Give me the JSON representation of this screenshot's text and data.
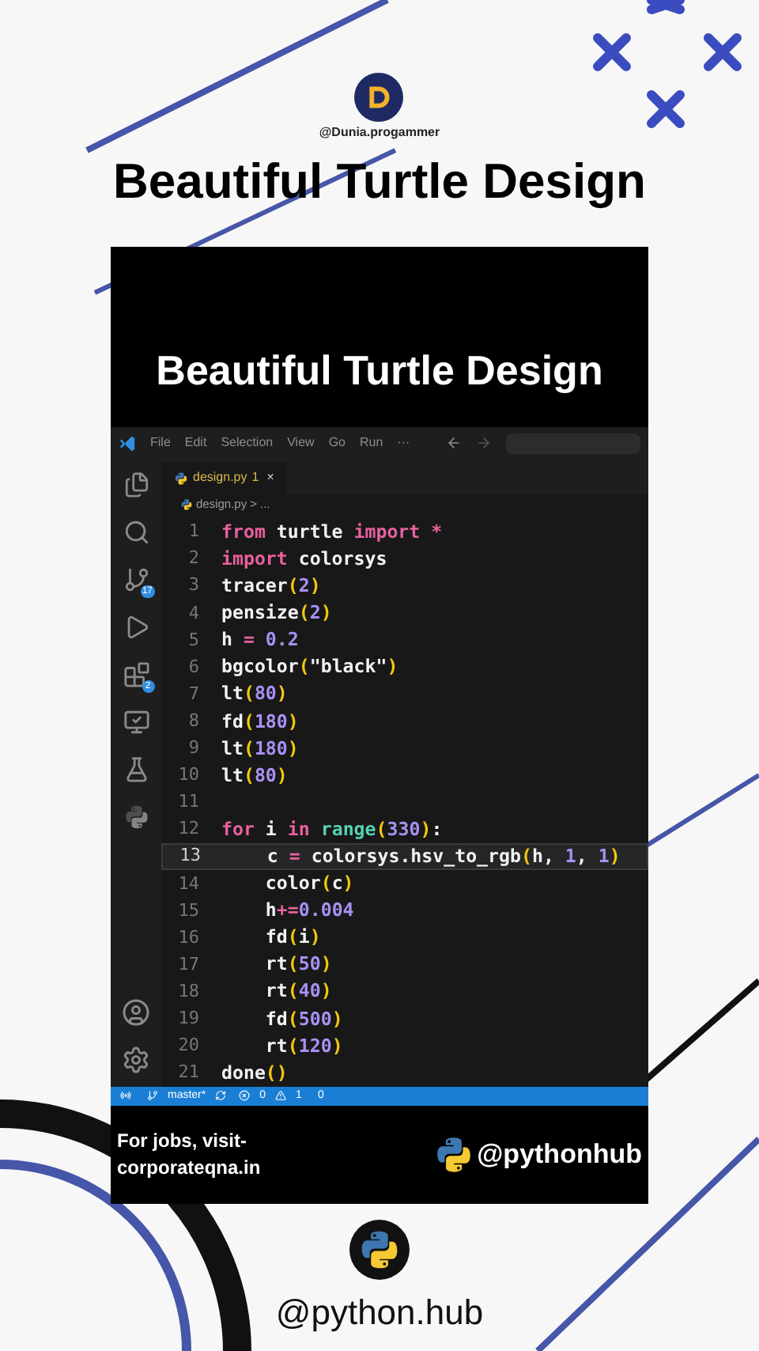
{
  "account": {
    "handle": "@Dunia.progammer"
  },
  "title": "Beautiful Turtle Design",
  "video": {
    "title": "Beautiful Turtle Design",
    "editor": {
      "menu": [
        "File",
        "Edit",
        "Selection",
        "View",
        "Go",
        "Run",
        "···"
      ],
      "activity": [
        {
          "kind": "files"
        },
        {
          "kind": "search"
        },
        {
          "kind": "scm",
          "badge": "17"
        },
        {
          "kind": "run"
        },
        {
          "kind": "extensions",
          "badge": "2"
        },
        {
          "kind": "remote"
        },
        {
          "kind": "testing"
        },
        {
          "kind": "python"
        }
      ],
      "activity_bottom": [
        {
          "kind": "account"
        },
        {
          "kind": "settings"
        }
      ],
      "tab": {
        "name": "design.py",
        "problems": "1",
        "close": "×"
      },
      "breadcrumb": [
        "design.py",
        ">",
        "..."
      ],
      "lines": [
        {
          "number": "1",
          "current": false,
          "tokens": [
            {
              "text": "from",
              "kind": "keyword"
            },
            {
              "text": " turtle ",
              "kind": "plain"
            },
            {
              "text": "import",
              "kind": "keyword"
            },
            {
              "text": " *",
              "kind": "keyword"
            }
          ]
        },
        {
          "number": "2",
          "current": false,
          "tokens": [
            {
              "text": "import",
              "kind": "keyword"
            },
            {
              "text": " colorsys",
              "kind": "plain"
            }
          ]
        },
        {
          "number": "3",
          "current": false,
          "tokens": [
            {
              "text": "tracer",
              "kind": "plain"
            },
            {
              "text": "(",
              "kind": "paren"
            },
            {
              "text": "2",
              "kind": "number"
            },
            {
              "text": ")",
              "kind": "paren"
            }
          ]
        },
        {
          "number": "4",
          "current": false,
          "tokens": [
            {
              "text": "pensize",
              "kind": "plain"
            },
            {
              "text": "(",
              "kind": "paren"
            },
            {
              "text": "2",
              "kind": "number"
            },
            {
              "text": ")",
              "kind": "paren"
            }
          ]
        },
        {
          "number": "5",
          "current": false,
          "tokens": [
            {
              "text": "h ",
              "kind": "plain"
            },
            {
              "text": "=",
              "kind": "keyword"
            },
            {
              "text": " 0.2",
              "kind": "number"
            }
          ]
        },
        {
          "number": "6",
          "current": false,
          "tokens": [
            {
              "text": "bgcolor",
              "kind": "plain"
            },
            {
              "text": "(",
              "kind": "paren"
            },
            {
              "text": "\"black\"",
              "kind": "string"
            },
            {
              "text": ")",
              "kind": "paren"
            }
          ]
        },
        {
          "number": "7",
          "current": false,
          "tokens": [
            {
              "text": "lt",
              "kind": "plain"
            },
            {
              "text": "(",
              "kind": "paren"
            },
            {
              "text": "80",
              "kind": "number"
            },
            {
              "text": ")",
              "kind": "paren"
            }
          ]
        },
        {
          "number": "8",
          "current": false,
          "tokens": [
            {
              "text": "fd",
              "kind": "plain"
            },
            {
              "text": "(",
              "kind": "paren"
            },
            {
              "text": "180",
              "kind": "number"
            },
            {
              "text": ")",
              "kind": "paren"
            }
          ]
        },
        {
          "number": "9",
          "current": false,
          "tokens": [
            {
              "text": "lt",
              "kind": "plain"
            },
            {
              "text": "(",
              "kind": "paren"
            },
            {
              "text": "180",
              "kind": "number"
            },
            {
              "text": ")",
              "kind": "paren"
            }
          ]
        },
        {
          "number": "10",
          "current": false,
          "tokens": [
            {
              "text": "lt",
              "kind": "plain"
            },
            {
              "text": "(",
              "kind": "paren"
            },
            {
              "text": "80",
              "kind": "number"
            },
            {
              "text": ")",
              "kind": "paren"
            }
          ]
        },
        {
          "number": "11",
          "current": false
        },
        {
          "number": "12",
          "current": false,
          "tokens": [
            {
              "text": "for",
              "kind": "keyword"
            },
            {
              "text": " i ",
              "kind": "plain"
            },
            {
              "text": "in",
              "kind": "keyword"
            },
            {
              "text": " range",
              "kind": "builtin"
            },
            {
              "text": "(",
              "kind": "paren"
            },
            {
              "text": "330",
              "kind": "number"
            },
            {
              "text": ")",
              "kind": "paren"
            },
            {
              "text": ":",
              "kind": "plain"
            }
          ]
        },
        {
          "number": "13",
          "current": true,
          "tokens": [
            {
              "text": "    c ",
              "kind": "plain"
            },
            {
              "text": "=",
              "kind": "keyword"
            },
            {
              "text": " colorsys.hsv_to_rgb",
              "kind": "plain"
            },
            {
              "text": "(",
              "kind": "paren"
            },
            {
              "text": "h, ",
              "kind": "plain"
            },
            {
              "text": "1",
              "kind": "number"
            },
            {
              "text": ", ",
              "kind": "plain"
            },
            {
              "text": "1",
              "kind": "number"
            },
            {
              "text": ")",
              "kind": "paren"
            }
          ]
        },
        {
          "number": "14",
          "current": false,
          "tokens": [
            {
              "text": "    color",
              "kind": "plain"
            },
            {
              "text": "(",
              "kind": "paren"
            },
            {
              "text": "c",
              "kind": "plain"
            },
            {
              "text": ")",
              "kind": "paren"
            }
          ]
        },
        {
          "number": "15",
          "current": false,
          "tokens": [
            {
              "text": "    h",
              "kind": "plain"
            },
            {
              "text": "+=",
              "kind": "keyword"
            },
            {
              "text": "0.004",
              "kind": "number"
            }
          ]
        },
        {
          "number": "16",
          "current": false,
          "tokens": [
            {
              "text": "    fd",
              "kind": "plain"
            },
            {
              "text": "(",
              "kind": "paren"
            },
            {
              "text": "i",
              "kind": "plain"
            },
            {
              "text": ")",
              "kind": "paren"
            }
          ]
        },
        {
          "number": "17",
          "current": false,
          "tokens": [
            {
              "text": "    rt",
              "kind": "plain"
            },
            {
              "text": "(",
              "kind": "paren"
            },
            {
              "text": "50",
              "kind": "number"
            },
            {
              "text": ")",
              "kind": "paren"
            }
          ]
        },
        {
          "number": "18",
          "current": false,
          "tokens": [
            {
              "text": "    rt",
              "kind": "plain"
            },
            {
              "text": "(",
              "kind": "paren"
            },
            {
              "text": "40",
              "kind": "number"
            },
            {
              "text": ")",
              "kind": "paren"
            }
          ]
        },
        {
          "number": "19",
          "current": false,
          "tokens": [
            {
              "text": "    fd",
              "kind": "plain"
            },
            {
              "text": "(",
              "kind": "paren"
            },
            {
              "text": "500",
              "kind": "number"
            },
            {
              "text": ")",
              "kind": "paren"
            }
          ]
        },
        {
          "number": "20",
          "current": false,
          "tokens": [
            {
              "text": "    rt",
              "kind": "plain"
            },
            {
              "text": "(",
              "kind": "paren"
            },
            {
              "text": "120",
              "kind": "number"
            },
            {
              "text": ")",
              "kind": "paren"
            }
          ]
        },
        {
          "number": "21",
          "current": false,
          "tokens": [
            {
              "text": "done",
              "kind": "plain"
            },
            {
              "text": "(",
              "kind": "paren"
            },
            {
              "text": ")",
              "kind": "paren"
            }
          ]
        }
      ],
      "status": {
        "branch": "master*",
        "errors": "0",
        "warnings": "1",
        "ports": "0"
      }
    },
    "footer_note": "For jobs, visit-\ncorporateqna.in",
    "channel": "@pythonhub"
  },
  "bottom_handle": "@python.hub"
}
